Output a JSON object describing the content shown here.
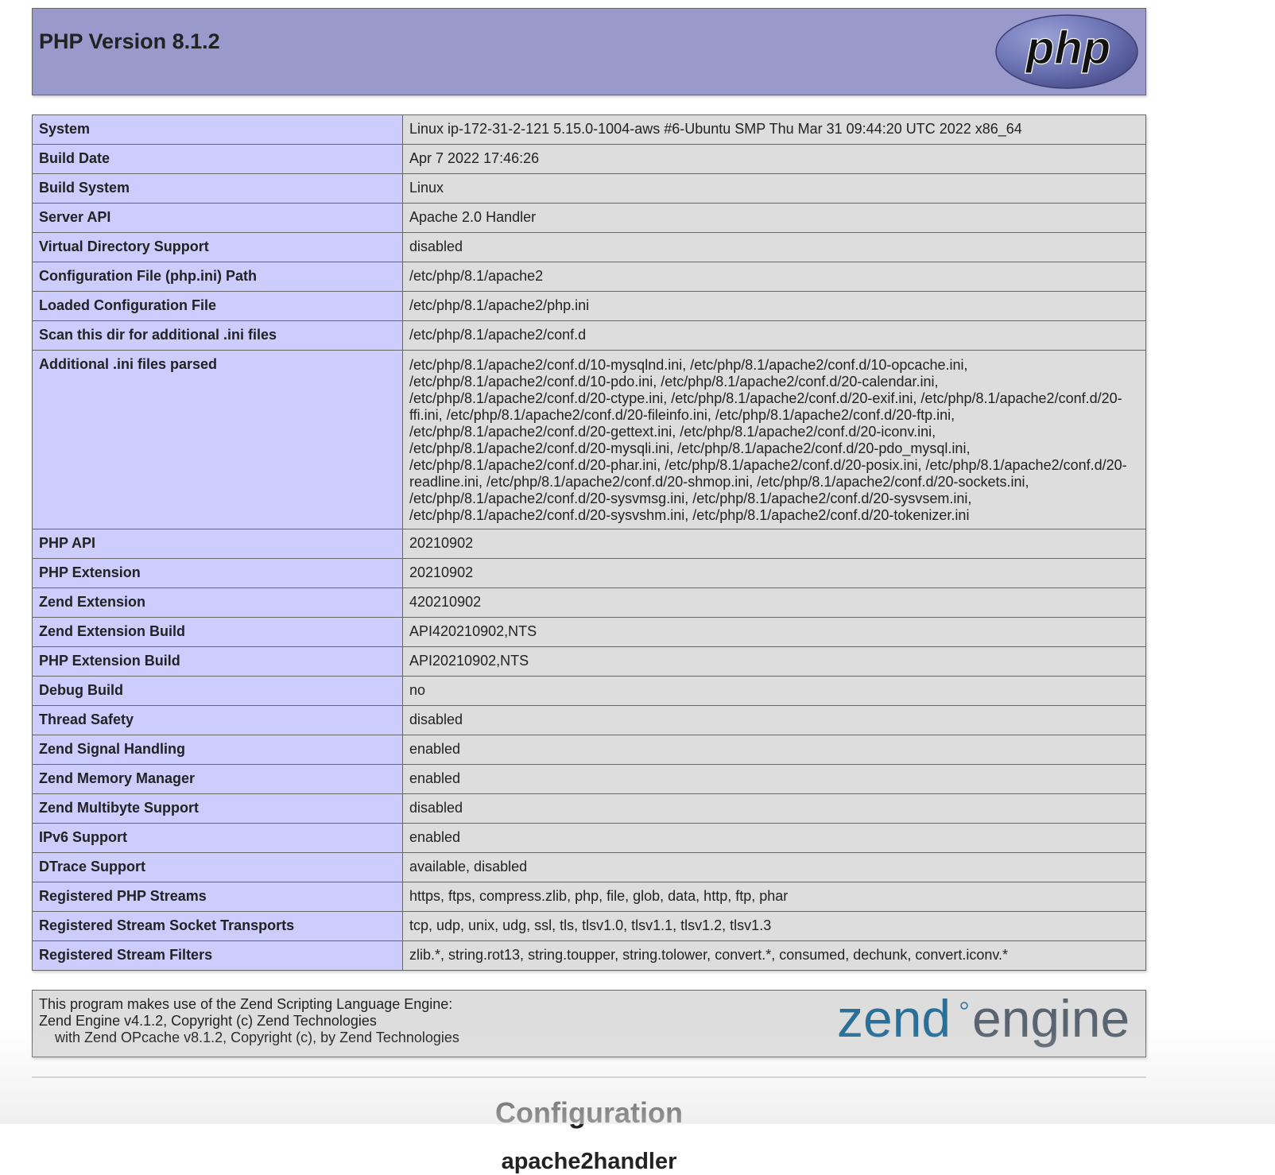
{
  "header": {
    "title": "PHP Version 8.1.2",
    "logo_text": "php"
  },
  "info_rows": [
    {
      "key": "System",
      "value": "Linux ip-172-31-2-121 5.15.0-1004-aws #6-Ubuntu SMP Thu Mar 31 09:44:20 UTC 2022 x86_64"
    },
    {
      "key": "Build Date",
      "value": "Apr 7 2022 17:46:26"
    },
    {
      "key": "Build System",
      "value": "Linux"
    },
    {
      "key": "Server API",
      "value": "Apache 2.0 Handler"
    },
    {
      "key": "Virtual Directory Support",
      "value": "disabled"
    },
    {
      "key": "Configuration File (php.ini) Path",
      "value": "/etc/php/8.1/apache2"
    },
    {
      "key": "Loaded Configuration File",
      "value": "/etc/php/8.1/apache2/php.ini"
    },
    {
      "key": "Scan this dir for additional .ini files",
      "value": "/etc/php/8.1/apache2/conf.d"
    },
    {
      "key": "Additional .ini files parsed",
      "value": "/etc/php/8.1/apache2/conf.d/10-mysqlnd.ini, /etc/php/8.1/apache2/conf.d/10-opcache.ini, /etc/php/8.1/apache2/conf.d/10-pdo.ini, /etc/php/8.1/apache2/conf.d/20-calendar.ini, /etc/php/8.1/apache2/conf.d/20-ctype.ini, /etc/php/8.1/apache2/conf.d/20-exif.ini, /etc/php/8.1/apache2/conf.d/20-ffi.ini, /etc/php/8.1/apache2/conf.d/20-fileinfo.ini, /etc/php/8.1/apache2/conf.d/20-ftp.ini, /etc/php/8.1/apache2/conf.d/20-gettext.ini, /etc/php/8.1/apache2/conf.d/20-iconv.ini, /etc/php/8.1/apache2/conf.d/20-mysqli.ini, /etc/php/8.1/apache2/conf.d/20-pdo_mysql.ini, /etc/php/8.1/apache2/conf.d/20-phar.ini, /etc/php/8.1/apache2/conf.d/20-posix.ini, /etc/php/8.1/apache2/conf.d/20-readline.ini, /etc/php/8.1/apache2/conf.d/20-shmop.ini, /etc/php/8.1/apache2/conf.d/20-sockets.ini, /etc/php/8.1/apache2/conf.d/20-sysvmsg.ini, /etc/php/8.1/apache2/conf.d/20-sysvsem.ini, /etc/php/8.1/apache2/conf.d/20-sysvshm.ini, /etc/php/8.1/apache2/conf.d/20-tokenizer.ini"
    },
    {
      "key": "PHP API",
      "value": "20210902"
    },
    {
      "key": "PHP Extension",
      "value": "20210902"
    },
    {
      "key": "Zend Extension",
      "value": "420210902"
    },
    {
      "key": "Zend Extension Build",
      "value": "API420210902,NTS"
    },
    {
      "key": "PHP Extension Build",
      "value": "API20210902,NTS"
    },
    {
      "key": "Debug Build",
      "value": "no"
    },
    {
      "key": "Thread Safety",
      "value": "disabled"
    },
    {
      "key": "Zend Signal Handling",
      "value": "enabled"
    },
    {
      "key": "Zend Memory Manager",
      "value": "enabled"
    },
    {
      "key": "Zend Multibyte Support",
      "value": "disabled"
    },
    {
      "key": "IPv6 Support",
      "value": "enabled"
    },
    {
      "key": "DTrace Support",
      "value": "available, disabled"
    },
    {
      "key": "Registered PHP Streams",
      "value": "https, ftps, compress.zlib, php, file, glob, data, http, ftp, phar"
    },
    {
      "key": "Registered Stream Socket Transports",
      "value": "tcp, udp, unix, udg, ssl, tls, tlsv1.0, tlsv1.1, tlsv1.2, tlsv1.3"
    },
    {
      "key": "Registered Stream Filters",
      "value": "zlib.*, string.rot13, string.toupper, string.tolower, convert.*, consumed, dechunk, convert.iconv.*"
    }
  ],
  "zend": {
    "line1": "This program makes use of the Zend Scripting Language Engine:",
    "line2": "Zend Engine v4.1.2, Copyright (c) Zend Technologies",
    "line3": "with Zend OPcache v8.1.2, Copyright (c), by Zend Technologies",
    "logo_word1": "zend",
    "logo_word2": "engine"
  },
  "sections": {
    "configuration_heading": "Configuration",
    "module_heading": "apache2handler"
  },
  "colors": {
    "header_bg": "#9999cc",
    "key_bg": "#ccccff",
    "value_bg": "#dddddd",
    "border": "#666666"
  }
}
